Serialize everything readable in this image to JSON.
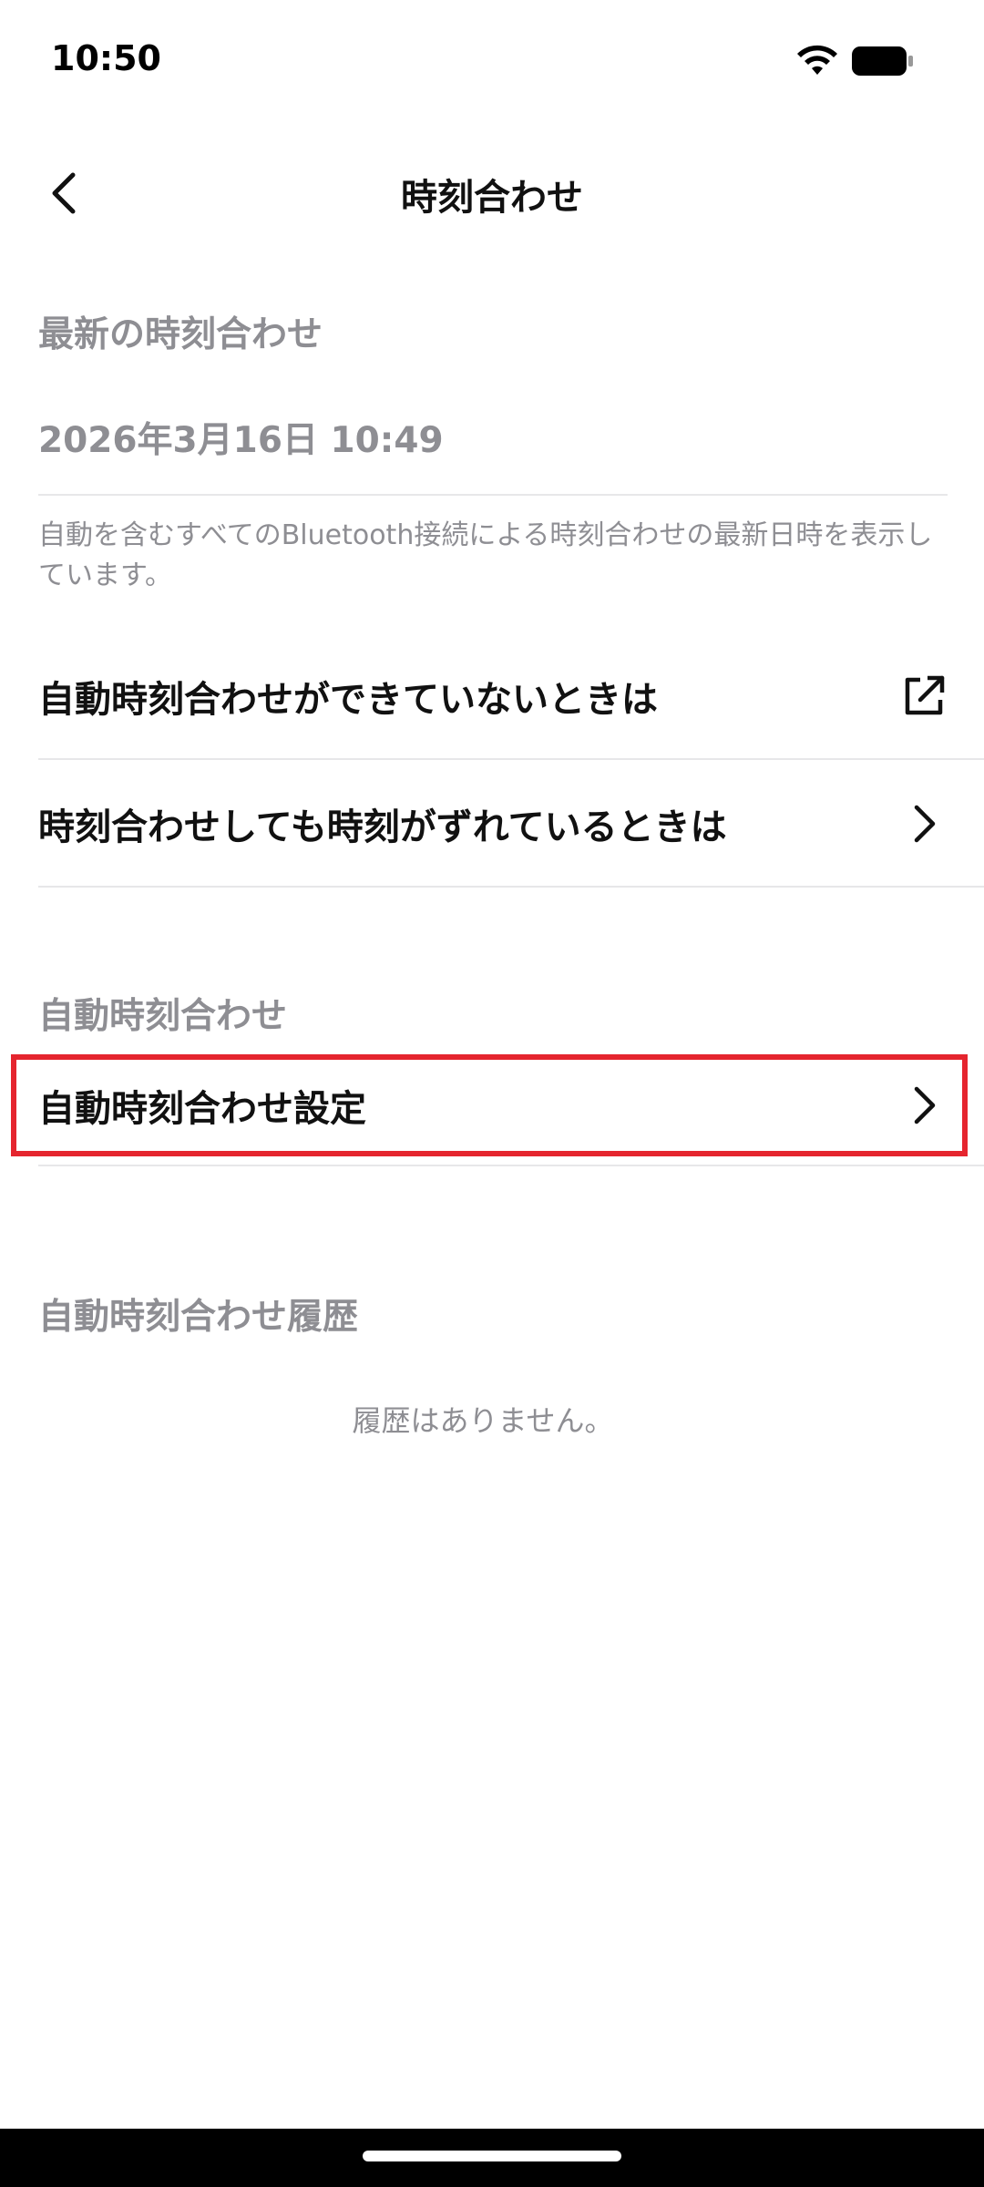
{
  "status_bar": {
    "time": "10:50",
    "wifi_icon": "wifi-icon",
    "battery_icon": "battery-icon"
  },
  "nav": {
    "title": "時刻合わせ",
    "back_icon": "chevron-left-icon"
  },
  "latest_sync": {
    "label": "最新の時刻合わせ",
    "value": "2026年3月16日 10:49",
    "description": "自動を含むすべてのBluetooth接続による時刻合わせの最新日時を表示しています。"
  },
  "help_links": [
    {
      "label": "自動時刻合わせができていないときは",
      "icon": "external-link-icon"
    },
    {
      "label": "時刻合わせしても時刻がずれているときは",
      "icon": "chevron-right-icon"
    }
  ],
  "auto_sync": {
    "section_label": "自動時刻合わせ",
    "settings_label": "自動時刻合わせ設定",
    "settings_icon": "chevron-right-icon"
  },
  "history": {
    "section_label": "自動時刻合わせ履歴",
    "empty_text": "履歴はありません。"
  },
  "colors": {
    "highlight": "#e5252e",
    "secondary_text": "#8e8e93",
    "primary_text": "#111111"
  }
}
